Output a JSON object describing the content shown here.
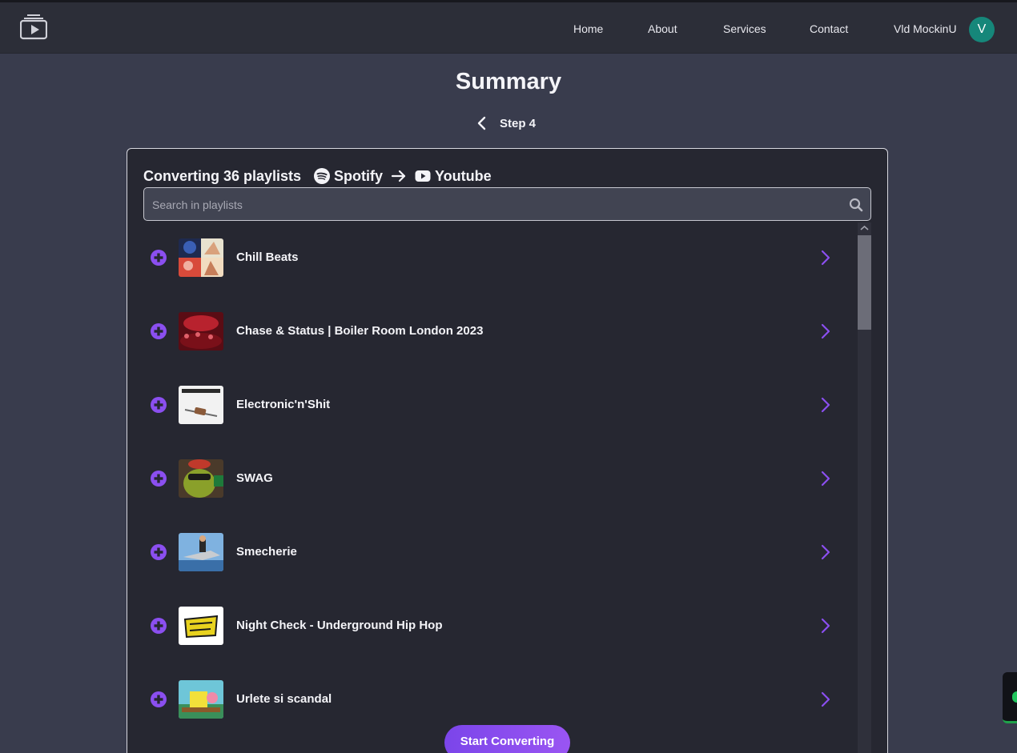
{
  "nav": {
    "links": [
      "Home",
      "About",
      "Services",
      "Contact"
    ],
    "user_name": "Vld MockinU",
    "avatar_initial": "V"
  },
  "page": {
    "title": "Summary",
    "step": "Step 4"
  },
  "conversion": {
    "summary": "Converting 36 playlists",
    "source": "Spotify",
    "destination": "Youtube"
  },
  "search": {
    "placeholder": "Search in playlists"
  },
  "playlists": [
    {
      "title": "Chill Beats"
    },
    {
      "title": "Chase & Status | Boiler Room London 2023"
    },
    {
      "title": "Electronic'n'Shit"
    },
    {
      "title": "SWAG"
    },
    {
      "title": "Smecherie"
    },
    {
      "title": "Night Check - Underground Hip Hop"
    },
    {
      "title": "Urlete si scandal"
    }
  ],
  "actions": {
    "start_label": "Start Converting"
  },
  "colors": {
    "accent": "#7b45ea",
    "avatar": "#16877a",
    "background": "#393c4d",
    "card": "#262731"
  },
  "icons": {
    "logo": "playlist-play-icon",
    "back": "chevron-left-icon",
    "spotify": "spotify-icon",
    "arrow": "arrow-right-icon",
    "youtube": "youtube-icon",
    "search": "search-icon",
    "add": "plus-circle-icon",
    "open": "chevron-right-icon"
  }
}
